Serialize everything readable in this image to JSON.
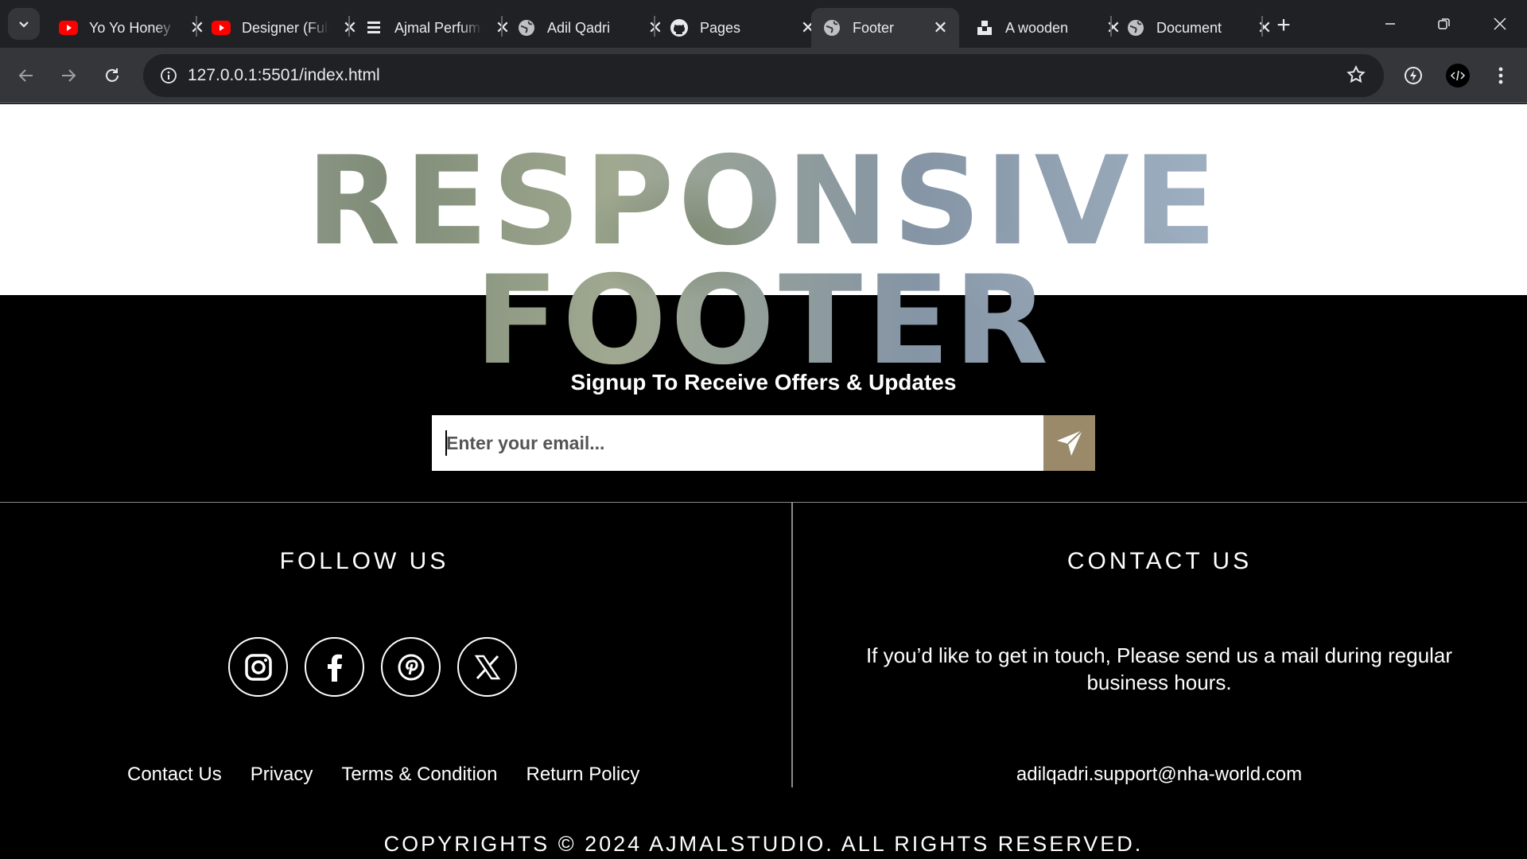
{
  "browser": {
    "tabs": [
      {
        "title": "Yo Yo Honey Singh",
        "favicon": "youtube-icon",
        "active": false
      },
      {
        "title": "Designer (Full Song)",
        "favicon": "youtube-icon",
        "active": false
      },
      {
        "title": "Ajmal Perfumes",
        "favicon": "ajmal-icon",
        "active": false
      },
      {
        "title": "Adil Qadri",
        "favicon": "globe-icon",
        "active": false
      },
      {
        "title": "Pages",
        "favicon": "github-icon",
        "active": false
      },
      {
        "title": "Footer",
        "favicon": "globe-icon",
        "active": true
      },
      {
        "title": "A wooden",
        "favicon": "unsplash-icon",
        "active": false
      },
      {
        "title": "Document",
        "favicon": "globe-icon",
        "active": false
      }
    ],
    "url": "127.0.0.1:5501/index.html"
  },
  "hero": {
    "title": "RESPONSIVE FOOTER"
  },
  "signup": {
    "title": "Signup To Receive Offers & Updates",
    "placeholder": "Enter your email...",
    "accent": "#9a8a6a"
  },
  "follow": {
    "title": "FOLLOW US",
    "socials": [
      "instagram-icon",
      "facebook-icon",
      "pinterest-icon",
      "x-icon"
    ],
    "links": [
      "Contact Us",
      "Privacy",
      "Terms & Condition",
      "Return Policy"
    ]
  },
  "contact": {
    "title": "CONTACT US",
    "text": "If you’d like to get in touch, Please send us a mail during regular business hours.",
    "email": "adilqadri.support@nha-world.com"
  },
  "copyright": "COPYRIGHTS © 2024 AJMALSTUDIO. ALL RIGHTS RESERVED."
}
